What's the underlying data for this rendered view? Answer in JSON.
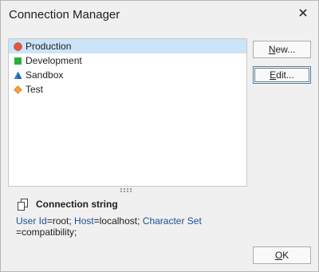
{
  "window": {
    "title": "Connection Manager"
  },
  "connections": [
    {
      "label": "Production",
      "icon": "red-circle-icon",
      "color": "#e8563f",
      "selected": true
    },
    {
      "label": "Development",
      "icon": "green-square-icon",
      "color": "#2fae3a",
      "selected": false
    },
    {
      "label": "Sandbox",
      "icon": "blue-triangle-icon",
      "color": "#2f7bd6",
      "selected": false
    },
    {
      "label": "Test",
      "icon": "orange-diamond-icon",
      "color": "#f0a23a",
      "selected": false
    }
  ],
  "buttons": {
    "new": {
      "mnemonic": "N",
      "rest": "ew..."
    },
    "edit": {
      "mnemonic": "E",
      "rest": "dit..."
    },
    "ok": {
      "mnemonic": "O",
      "rest": "K"
    }
  },
  "connection_string": {
    "title": "Connection string",
    "parts": {
      "k1": "User Id",
      "v1": "=root; ",
      "k2": "Host",
      "v2": "=localhost; ",
      "k3": "Character Set",
      "v3": "=compatibility;"
    }
  },
  "colors": {
    "keyword": "#1a4f96",
    "selection": "#cce4f7",
    "dialog_background": "#f0f0f0"
  }
}
